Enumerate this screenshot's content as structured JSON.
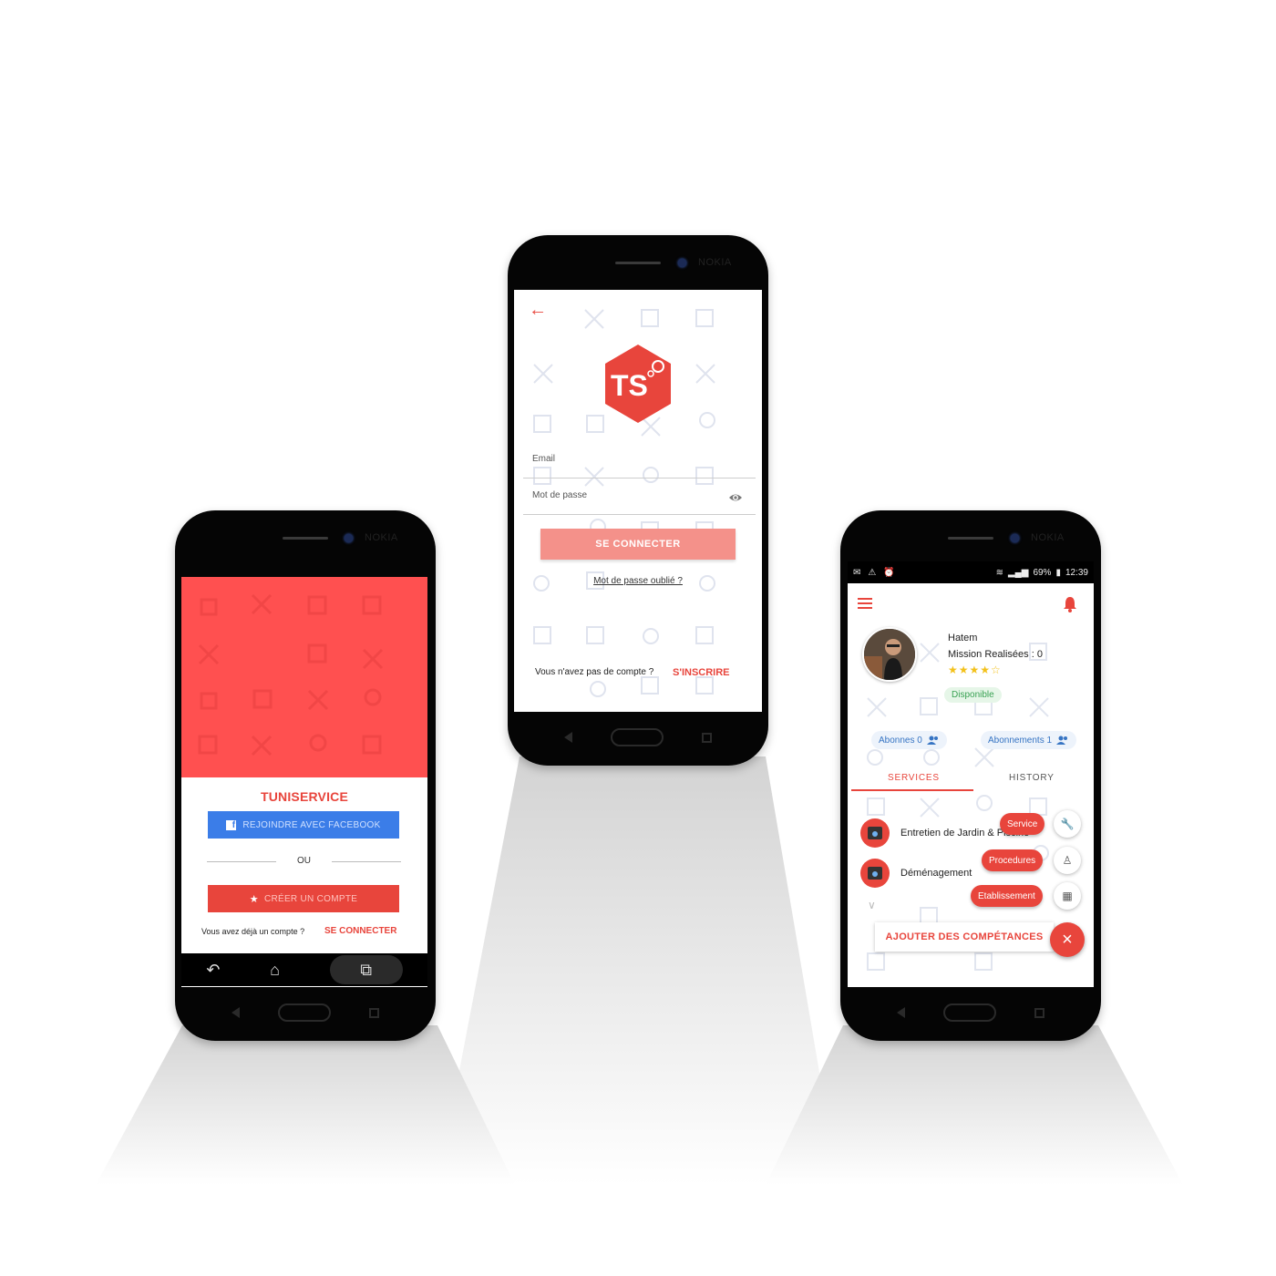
{
  "device_brand": "NOKIA",
  "phone_left": {
    "app_name": "TUNISERVICE",
    "facebook_button": "REJOINDRE AVEC FACEBOOK",
    "facebook_icon": "facebook-icon",
    "separator": "OU",
    "create_account_button": "CRÉER UN COMPTE",
    "have_account_text": "Vous avez déjà un compte ?",
    "login_link": "SE CONNECTER",
    "hero_color": "#ff5050",
    "accent_color": "#e8453c",
    "facebook_color": "#3b7de8",
    "system_nav": [
      "↶",
      "⌂",
      "⧉"
    ]
  },
  "phone_center": {
    "logo_text": "TS",
    "email_label": "Email",
    "password_label": "Mot de passe",
    "login_button": "SE CONNECTER",
    "forgot_password": "Mot de passe oublié ?",
    "no_account_text": "Vous n'avez pas de compte ?",
    "signup_link": "S'INSCRIRE",
    "button_color": "#f4918a"
  },
  "phone_right": {
    "status_bar": {
      "battery": "69%",
      "time": "12:39"
    },
    "profile": {
      "name": "Hatem",
      "missions": "Mission Realisées : 0",
      "rating": 4,
      "rating_max": 5,
      "stars_text": "★★★★☆",
      "availability": "Disponible"
    },
    "followers": "Abonnes 0",
    "subscriptions": "Abonnements 1",
    "tabs": [
      "SERVICES",
      "HISTORY"
    ],
    "services": [
      "Entretien de Jardin & Piscine",
      "Déménagement"
    ],
    "fab_menu": [
      "Service",
      "Procedures",
      "Etablissement"
    ],
    "add_skills_button": "AJOUTER DES COMPÉTANCES",
    "close_icon": "×"
  }
}
